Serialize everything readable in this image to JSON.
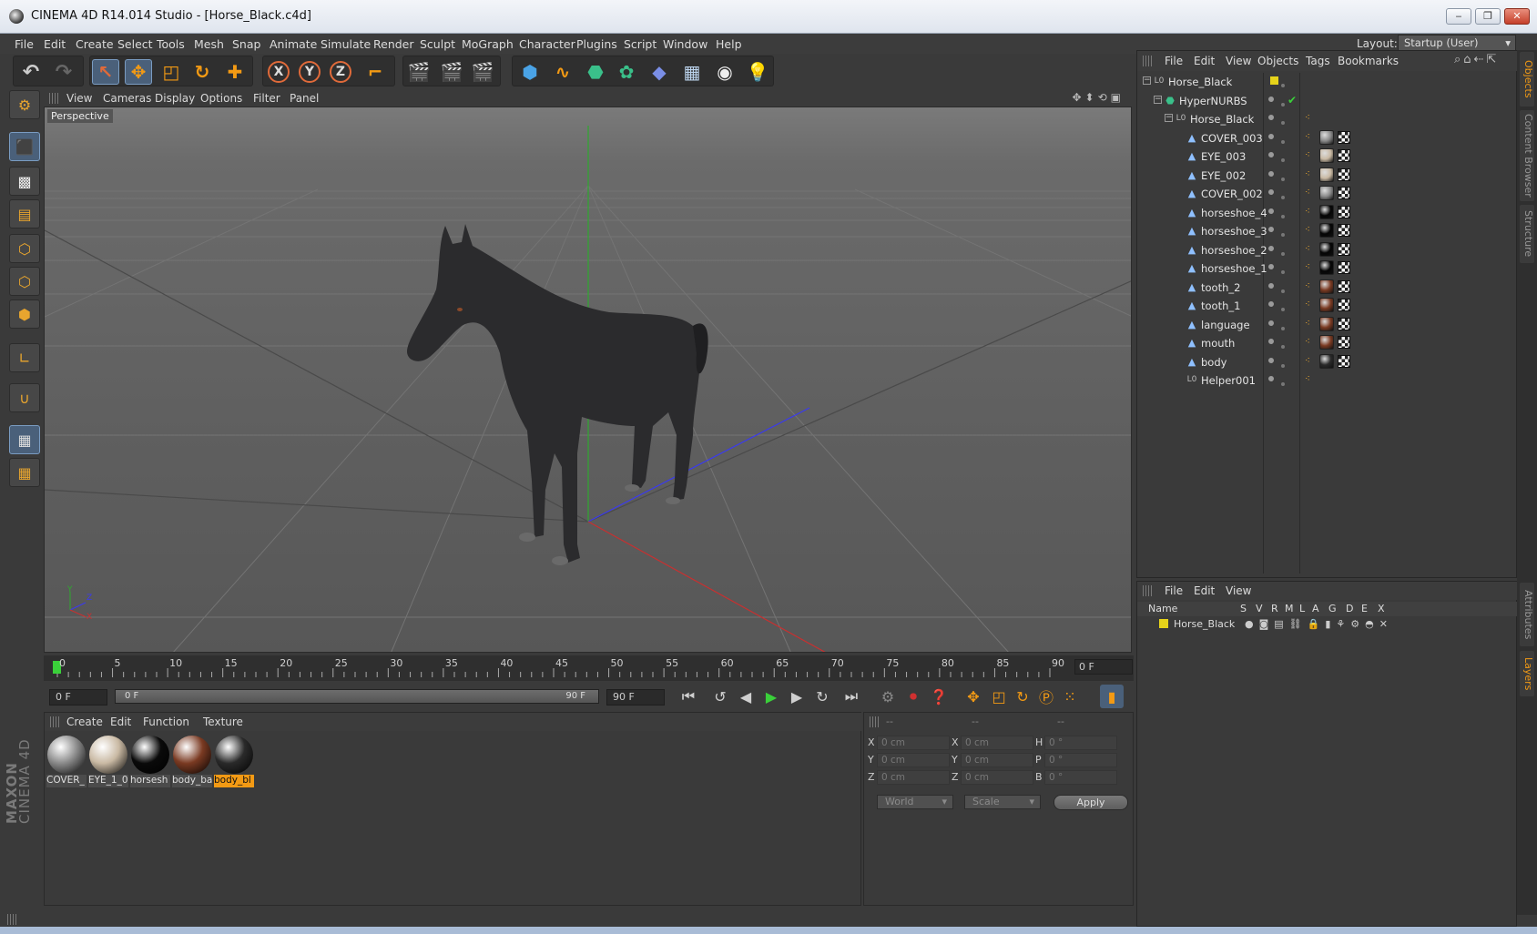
{
  "window": {
    "title": "CINEMA 4D R14.014 Studio - [Horse_Black.c4d]",
    "controls": [
      "‒",
      "❐",
      "✕"
    ]
  },
  "menubar": {
    "items": [
      "File",
      "Edit",
      "Create",
      "Select",
      "Tools",
      "Mesh",
      "Snap",
      "Animate",
      "Simulate",
      "Render",
      "Sculpt",
      "MoGraph",
      "Character",
      "Plugins",
      "Script",
      "Window",
      "Help"
    ],
    "layout_label": "Layout:",
    "layout_value": "Startup (User)"
  },
  "toolbar": {
    "axis_labels": [
      "X",
      "Y",
      "Z"
    ]
  },
  "viewport": {
    "menu": [
      "View",
      "Cameras",
      "Display",
      "Options",
      "Filter",
      "Panel"
    ],
    "camera_label": "Perspective",
    "axis_y": "Y",
    "axis_z": "Z",
    "axis_x": "X"
  },
  "timeline": {
    "ticks": [
      "0",
      "5",
      "10",
      "15",
      "20",
      "25",
      "30",
      "35",
      "40",
      "45",
      "50",
      "55",
      "60",
      "65",
      "70",
      "75",
      "80",
      "85",
      "90"
    ],
    "current_frame": "0 F",
    "start_frame": "0 F",
    "slider_start": "0 F",
    "slider_end": "90 F",
    "end_frame": "90 F",
    "end_field": "90 F"
  },
  "material_manager": {
    "menu": [
      "Create",
      "Edit",
      "Function",
      "Texture"
    ],
    "materials": [
      {
        "label": "COVER_",
        "color": "#8a8a8a"
      },
      {
        "label": "EYE_1_0(",
        "color": "#c9b9a3"
      },
      {
        "label": "horsesh",
        "color": "#0a0a0a"
      },
      {
        "label": "body_ba",
        "color": "#7a3a22"
      },
      {
        "label": "body_bl",
        "color": "#2a2a2a",
        "selected": true
      }
    ]
  },
  "coordinates": {
    "headers": [
      "--",
      "--",
      "--"
    ],
    "rows": [
      {
        "a": "X",
        "av": "0 cm",
        "b": "X",
        "bv": "0 cm",
        "c": "H",
        "cv": "0 °"
      },
      {
        "a": "Y",
        "av": "0 cm",
        "b": "Y",
        "bv": "0 cm",
        "c": "P",
        "cv": "0 °"
      },
      {
        "a": "Z",
        "av": "0 cm",
        "b": "Z",
        "bv": "0 cm",
        "c": "B",
        "cv": "0 °"
      }
    ],
    "space": "World",
    "mode": "Scale",
    "apply": "Apply"
  },
  "object_manager": {
    "menu": [
      "File",
      "Edit",
      "View",
      "Objects",
      "Tags",
      "Bookmarks"
    ],
    "objects": [
      {
        "name": "Horse_Black",
        "indent": 0,
        "type": "null"
      },
      {
        "name": "HyperNURBS",
        "indent": 1,
        "type": "nurbs"
      },
      {
        "name": "Horse_Black",
        "indent": 2,
        "type": "null"
      },
      {
        "name": "COVER_003",
        "indent": 3,
        "type": "mesh",
        "mat": "#8a8a8a"
      },
      {
        "name": "EYE_003",
        "indent": 3,
        "type": "mesh",
        "mat": "#c9b9a3"
      },
      {
        "name": "EYE_002",
        "indent": 3,
        "type": "mesh",
        "mat": "#c9b9a3"
      },
      {
        "name": "COVER_002",
        "indent": 3,
        "type": "mesh",
        "mat": "#8a8a8a"
      },
      {
        "name": "horseshoe_4",
        "indent": 3,
        "type": "mesh",
        "mat": "#050505"
      },
      {
        "name": "horseshoe_3",
        "indent": 3,
        "type": "mesh",
        "mat": "#050505"
      },
      {
        "name": "horseshoe_2",
        "indent": 3,
        "type": "mesh",
        "mat": "#050505"
      },
      {
        "name": "horseshoe_1",
        "indent": 3,
        "type": "mesh",
        "mat": "#050505"
      },
      {
        "name": "tooth_2",
        "indent": 3,
        "type": "mesh",
        "mat": "#7a3a22"
      },
      {
        "name": "tooth_1",
        "indent": 3,
        "type": "mesh",
        "mat": "#7a3a22"
      },
      {
        "name": "language",
        "indent": 3,
        "type": "mesh",
        "mat": "#7a3a22"
      },
      {
        "name": "mouth",
        "indent": 3,
        "type": "mesh",
        "mat": "#7a3a22"
      },
      {
        "name": "body",
        "indent": 3,
        "type": "mesh",
        "mat": "#2a2a2a"
      },
      {
        "name": "Helper001",
        "indent": 3,
        "type": "null"
      }
    ]
  },
  "layer_manager": {
    "menu": [
      "File",
      "Edit",
      "View"
    ],
    "columns": [
      "Name",
      "S",
      "V",
      "R",
      "M",
      "L",
      "A",
      "G",
      "D",
      "E",
      "X"
    ],
    "layer_name": "Horse_Black",
    "layer_color": "#e6d31a"
  },
  "side_tabs": [
    "Objects",
    "Content Browser",
    "Structure",
    "Attributes",
    "Layers"
  ],
  "branding": {
    "line1": "MAXON",
    "line2": "CINEMA 4D"
  },
  "colors": {
    "accent": "#f39a14",
    "selection": "#4a607a"
  }
}
